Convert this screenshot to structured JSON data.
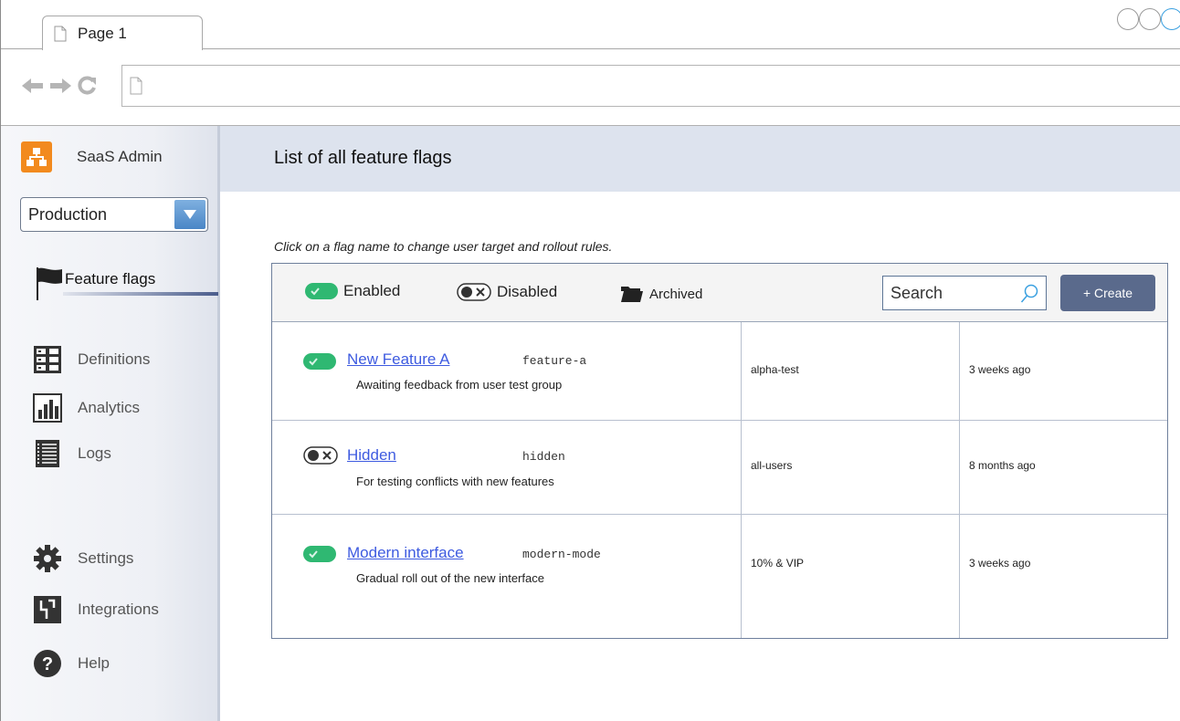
{
  "browser": {
    "tab_title": "Page 1"
  },
  "sidebar": {
    "brand": "SaaS Admin",
    "environment": "Production",
    "active_item": "Feature flags",
    "items": [
      {
        "label": "Definitions",
        "icon": "definitions-icon"
      },
      {
        "label": "Analytics",
        "icon": "bar-chart-icon"
      },
      {
        "label": "Logs",
        "icon": "list-icon"
      },
      {
        "label": "Settings",
        "icon": "gear-icon"
      },
      {
        "label": "Integrations",
        "icon": "integrations-icon"
      },
      {
        "label": "Help",
        "icon": "help-icon"
      }
    ]
  },
  "main": {
    "title": "List of all feature flags",
    "hint": "Click on a flag name to change user target and rollout rules.",
    "filters": {
      "enabled": "Enabled",
      "disabled": "Disabled",
      "archived": "Archived"
    },
    "search_placeholder": "Search",
    "create_label": "+ Create",
    "flags": [
      {
        "enabled": true,
        "name": "New Feature A",
        "key": "feature-a",
        "description": "Awaiting feedback from user test group",
        "target": "alpha-test",
        "updated": "3 weeks ago"
      },
      {
        "enabled": false,
        "name": "Hidden",
        "key": "hidden",
        "description": "For testing conflicts with new features",
        "target": "all-users",
        "updated": "8 months ago"
      },
      {
        "enabled": true,
        "name": "Modern interface",
        "key": "modern-mode",
        "description": "Gradual roll out of the new interface",
        "target": "10% & VIP",
        "updated": "3 weeks ago"
      }
    ]
  },
  "colors": {
    "toggle_on": "#2fb872",
    "link": "#3e5be0",
    "create_button": "#5a6a8c",
    "brand": "#f28a1e",
    "header_bg": "#dde3ee"
  }
}
